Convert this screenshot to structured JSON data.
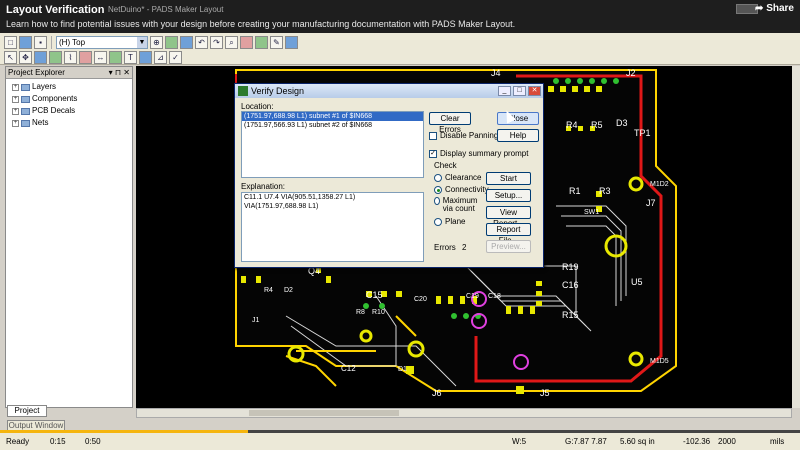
{
  "header": {
    "title": "Layout Verification",
    "subtitle": "Learn how to find potential issues with your design before creating your manufacturing documentation with PADS Maker Layout.",
    "window_title": "NetDuino* - PADS Maker Layout",
    "share_label": "Share"
  },
  "toolbar": {
    "layer_value": "(H) Top"
  },
  "explorer": {
    "title": "Project Explorer",
    "items": [
      {
        "label": "Layers"
      },
      {
        "label": "Components"
      },
      {
        "label": "PCB Decals"
      },
      {
        "label": "Nets"
      }
    ],
    "tab_project": "Project",
    "tab_output": "Output Window"
  },
  "dialog": {
    "title": "Verify Design",
    "location_label": "Location:",
    "locations": [
      "(1751.97,688.98 L1) subnet #1 of $IN668",
      "(1751.97,566.93 L1) subnet #2 of $IN668"
    ],
    "explanation_label": "Explanation:",
    "explanation": [
      "C11.1 U7.4 VIA(905.51,1358.27 L1)",
      "VIA(1751.97,688.98 L1)"
    ],
    "clear_errors": "Clear Errors",
    "close": "Close",
    "disable_panning": "Disable Panning",
    "help": "Help",
    "display_summary": "Display summary prompt",
    "check_label": "Check",
    "checks": [
      "Clearance",
      "Connectivity",
      "Maximum via count",
      "Plane"
    ],
    "start": "Start",
    "setup": "Setup...",
    "view_report": "View Report...",
    "report_file": "Report File...",
    "preview": "Preview...",
    "errors_label": "Errors",
    "errors_count": "2"
  },
  "canvas": {
    "labels": [
      "J4",
      "J2",
      "TP1",
      "D3",
      "R5",
      "R4",
      "R1",
      "R3",
      "SW1",
      "J7",
      "U5",
      "R19",
      "C16",
      "R15",
      "C15",
      "R8",
      "R10",
      "C20",
      "C19",
      "C18",
      "Q4",
      "R4",
      "D2",
      "J1",
      "C12",
      "D1",
      "J6",
      "J5",
      "M1D2",
      "M1D5"
    ]
  },
  "status": {
    "ready": "Ready",
    "time_current": "0:15",
    "time_total": "0:50",
    "w": "W:5",
    "g": "G:7.87 7.87",
    "area": "5.60 sq in",
    "x": "-102.36",
    "y": "2000",
    "units": "mils"
  },
  "progress": 0.31
}
